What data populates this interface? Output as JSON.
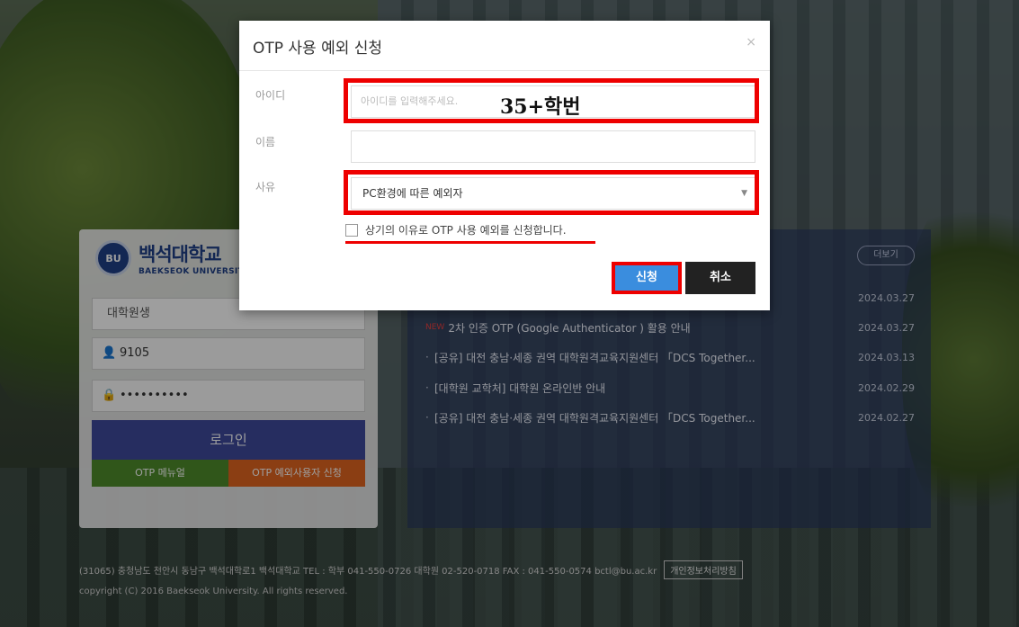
{
  "login": {
    "logo_badge": "BU",
    "logo_ko": "백석대학교",
    "logo_en": "BAEKSEOK UNIVERSITY",
    "role": "대학원생",
    "user_id": "9105",
    "password_mask": "••••••••••",
    "login_button": "로그인",
    "otp_manual": "OTP 메뉴얼",
    "otp_exception_apply": "OTP 예외사용자 신청"
  },
  "notice": {
    "more": "더보기",
    "items": [
      {
        "text": "",
        "date": "2024.03.27"
      },
      {
        "new": "NEW",
        "text": "2차 인증 OTP (Google Authenticator ) 활용 안내",
        "date": "2024.03.27"
      },
      {
        "text": "[공유] 대전 충남·세종 권역 대학원격교육지원센터 「DCS Together...",
        "date": "2024.03.13"
      },
      {
        "text": "[대학원 교학처] 대학원 온라인반 안내",
        "date": "2024.02.29"
      },
      {
        "text": "[공유] 대전 충남·세종 권역 대학원격교육지원센터 「DCS Together...",
        "date": "2024.02.27"
      }
    ]
  },
  "footer": {
    "address": "(31065) 충청남도 천안시 동남구 백석대학로1 백석대학교 TEL : 학부 041-550-0726 대학원 02-520-0718 FAX : 041-550-0574 bctl@bu.ac.kr",
    "privacy": "개인정보처리방침",
    "copyright": "copyright (C) 2016 Baekseok University. All rights reserved."
  },
  "modal": {
    "title": "OTP 사용 예외 신청",
    "close": "×",
    "id_label": "아이디",
    "id_placeholder": "아이디를 입력해주세요.",
    "annotation": "35+학번",
    "name_label": "이름",
    "name_value": "",
    "reason_label": "사유",
    "reason_value": "PC환경에 따른 예외자",
    "agree_text": "상기의 이유로 OTP 사용 예외를 신청합니다.",
    "apply_button": "신청",
    "cancel_button": "취소"
  },
  "colors": {
    "highlight": "#ee0000",
    "apply": "#3a8dde",
    "login": "#3e4a9b",
    "manual": "#4e8c2a",
    "exception": "#e1651f"
  }
}
